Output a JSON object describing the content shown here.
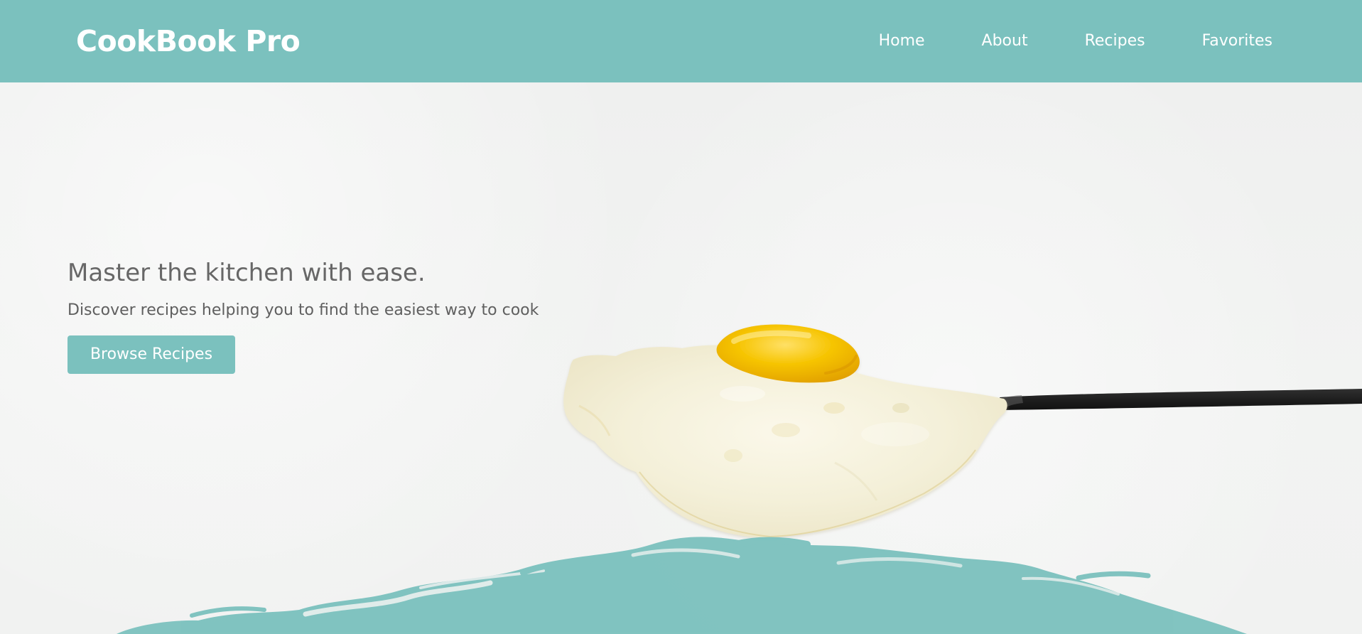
{
  "header": {
    "brand": "CookBook Pro",
    "nav": [
      {
        "label": "Home"
      },
      {
        "label": "About"
      },
      {
        "label": "Recipes"
      },
      {
        "label": "Favorites"
      }
    ]
  },
  "hero": {
    "title": "Master the kitchen with ease.",
    "subtitle": "Discover recipes helping you to find the easiest way to cook",
    "button_label": "Browse Recipes",
    "image": "fried-egg-on-spoon"
  },
  "colors": {
    "accent": "#7bc1be",
    "background": "#f0f1f0",
    "text": "#676767",
    "egg_white": "#f4f0dc",
    "egg_yolk": "#f0c000",
    "spoon_handle": "#1f1f1f"
  }
}
